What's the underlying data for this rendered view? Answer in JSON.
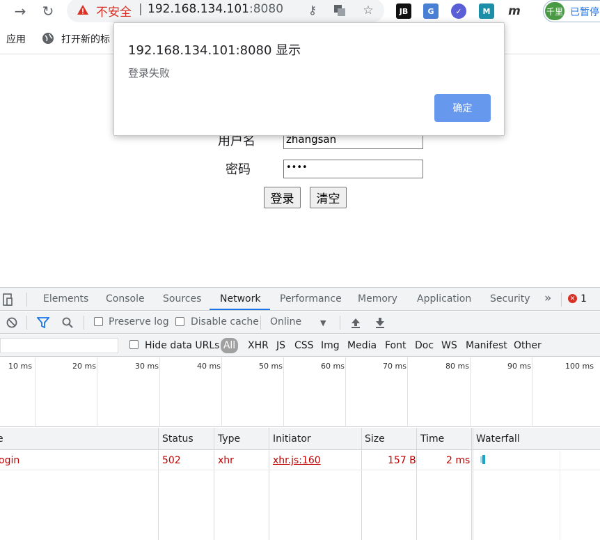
{
  "browser": {
    "insecure_label": "不安全",
    "separator": "|",
    "url_host": "192.168.134.101",
    "url_port": ":8080",
    "profile_avatar": "千里",
    "profile_status": "已暂停",
    "extensions": {
      "jb": "JB",
      "m": "M",
      "m_italic": "m"
    }
  },
  "bookmarks": {
    "apps": "应用",
    "new_tab": "打开新的标"
  },
  "page": {
    "username_label": "用户名",
    "username_value": "zhangsan",
    "password_label": "密码",
    "password_value": "••••",
    "login_button": "登录",
    "clear_button": "清空"
  },
  "dialog": {
    "title": "192.168.134.101:8080 显示",
    "message": "登录失败",
    "ok_button": "确定"
  },
  "devtools": {
    "tabs": [
      "Elements",
      "Console",
      "Sources",
      "Network",
      "Performance",
      "Memory",
      "Application",
      "Security"
    ],
    "active_tab": "Network",
    "more_tabs": "»",
    "error_count": "1",
    "toolbar": {
      "preserve_log": "Preserve log",
      "disable_cache": "Disable cache",
      "throttling": "Online"
    },
    "filter": {
      "hide_data_urls": "Hide data URLs",
      "types": [
        "All",
        "XHR",
        "JS",
        "CSS",
        "Img",
        "Media",
        "Font",
        "Doc",
        "WS",
        "Manifest",
        "Other"
      ]
    },
    "timeline_ticks": [
      "10 ms",
      "20 ms",
      "30 ms",
      "40 ms",
      "50 ms",
      "60 ms",
      "70 ms",
      "80 ms",
      "90 ms",
      "100 ms"
    ],
    "columns": [
      "e",
      "Status",
      "Type",
      "Initiator",
      "Size",
      "Time",
      "Waterfall"
    ],
    "rows": [
      {
        "name": "ogin",
        "status": "502",
        "type": "xhr",
        "initiator": "xhr.js:160",
        "size": "157 B",
        "time": "2 ms"
      }
    ],
    "colors": {
      "error_red": "#c00000",
      "active_blue": "#1a73e8"
    }
  }
}
